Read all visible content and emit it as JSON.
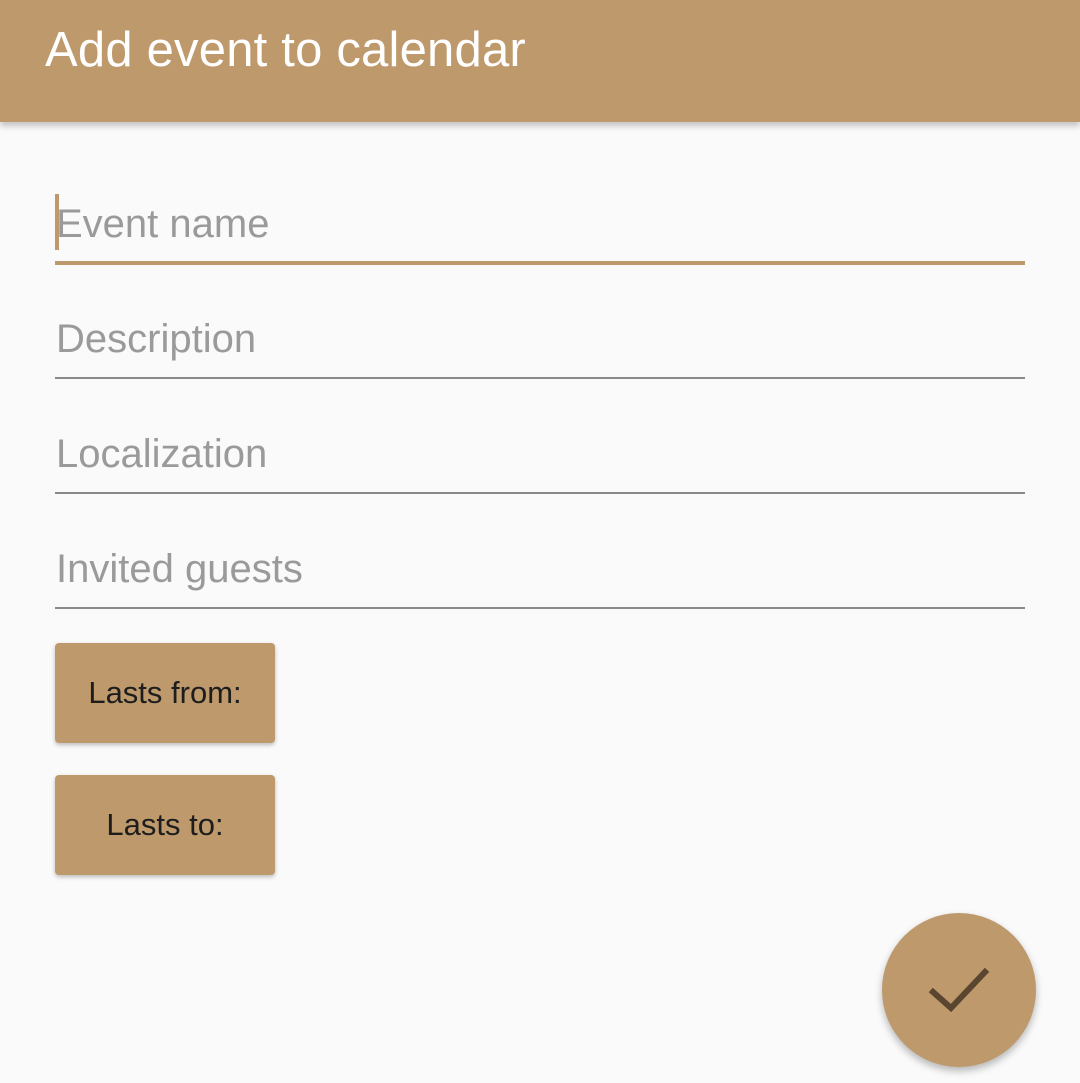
{
  "app_bar": {
    "title": "Add event to calendar",
    "color": "#be996b"
  },
  "form": {
    "event_name": {
      "placeholder": "Event name",
      "value": ""
    },
    "description": {
      "placeholder": "Description",
      "value": ""
    },
    "localization": {
      "placeholder": "Localization",
      "value": ""
    },
    "invited_guests": {
      "placeholder": "Invited guests",
      "value": ""
    }
  },
  "buttons": {
    "lasts_from": "Lasts from:",
    "lasts_to": "Lasts to:"
  },
  "fab": {
    "icon": "check-icon"
  }
}
